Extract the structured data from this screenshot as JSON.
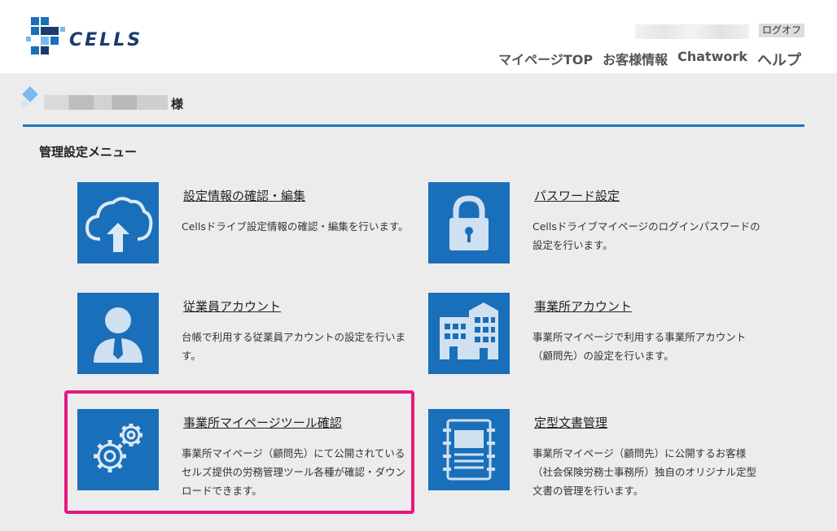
{
  "header": {
    "logo_text": "CELLS",
    "logout_label": "ログオフ",
    "nav": [
      "マイページTOP",
      "お客様情報",
      "Chatwork",
      "ヘルプ"
    ]
  },
  "welcome": {
    "suffix": "様"
  },
  "section_title": "管理設定メニュー",
  "menu": [
    {
      "title": "設定情報の確認・編集",
      "desc": "Cellsドライブ設定情報の確認・編集を行います。",
      "icon": "cloud-upload-icon"
    },
    {
      "title": "パスワード設定",
      "desc": "Cellsドライブマイページのログインパスワードの設定を行います。",
      "icon": "lock-icon"
    },
    {
      "title": "従業員アカウント",
      "desc": "台帳で利用する従業員アカウントの設定を行います。",
      "icon": "employee-icon"
    },
    {
      "title": "事業所アカウント",
      "desc": "事業所マイページで利用する事業所アカウント（顧問先）の設定を行います。",
      "icon": "building-icon"
    },
    {
      "title": "事業所マイページツール確認",
      "desc": "事業所マイページ（顧問先）にて公開されているセルズ提供の労務管理ツール各種が確認・ダウンロードできます。",
      "icon": "gears-icon"
    },
    {
      "title": "定型文書管理",
      "desc": "事業所マイページ（顧問先）に公開するお客様（社会保険労務士事務所）独自のオリジナル定型文書の管理を行います。",
      "icon": "document-icon"
    }
  ],
  "colors": {
    "accent_blue": "#1a6fba",
    "highlight_pink": "#e6197c"
  }
}
